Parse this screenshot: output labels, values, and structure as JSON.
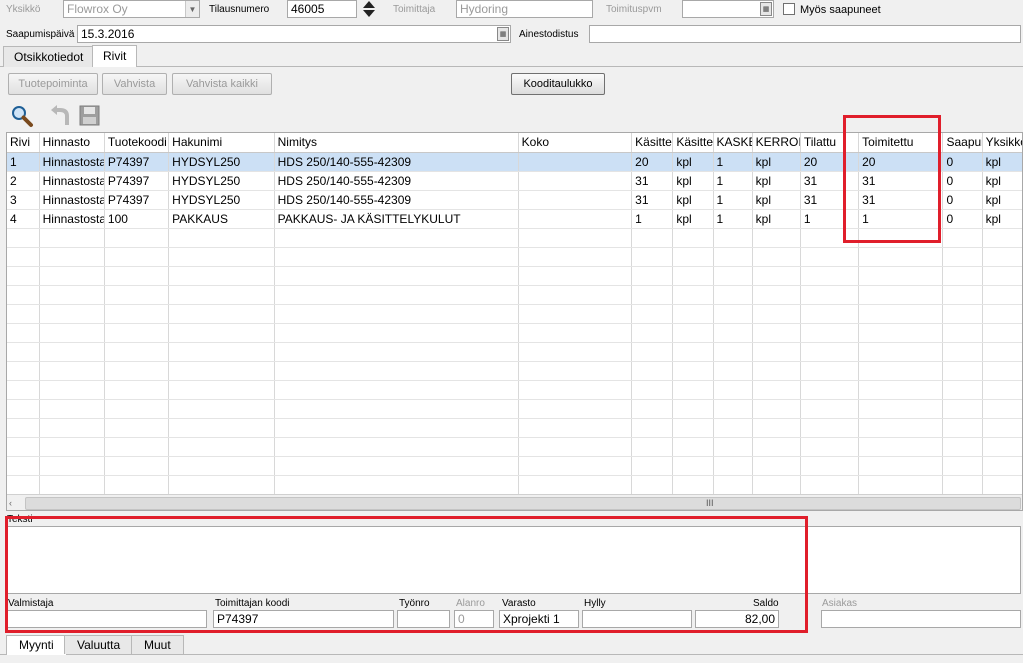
{
  "header": {
    "yksikko_label": "Yksikkö",
    "yksikko_value": "Flowrox Oy",
    "tilausnumero_label": "Tilausnumero",
    "tilausnumero_value": "46005",
    "toimittaja_label": "Toimittaja",
    "toimittaja_value": "Hydoring",
    "toimituspvm_label": "Toimituspvm",
    "toimituspvm_value": "",
    "myos_saapuneet_label": "Myös saapuneet",
    "saapumispaiva_label": "Saapumispäivä",
    "saapumispaiva_value": "15.3.2016",
    "ainestodistus_label": "Ainestodistus",
    "ainestodistus_value": ""
  },
  "tabs": [
    {
      "label": "Otsikkotiedot"
    },
    {
      "label": "Rivit"
    }
  ],
  "buttons": {
    "tuotepoiminta": "Tuotepoiminta",
    "vahvista": "Vahvista",
    "vahvista_kaikki": "Vahvista kaikki",
    "kooditaulukko": "Kooditaulukko"
  },
  "toolbar_icons": [
    "search-icon",
    "undo-icon",
    "save-icon"
  ],
  "grid": {
    "columns": [
      "Rivi",
      "Hinnasto",
      "Tuotekoodi",
      "Hakunimi",
      "Nimitys",
      "Koko",
      "Käsitte",
      "Käsitte",
      "KASKEI",
      "KERROIN",
      "Tilattu",
      "Toimitettu",
      "Saapui",
      "Yksikkö"
    ],
    "rows": [
      [
        "1",
        "Hinnastosta",
        "P74397",
        "HYDSYL250",
        "HDS 250/140-555-42309",
        "",
        "20",
        "kpl",
        "1",
        "kpl",
        "20",
        "20",
        "0",
        "kpl"
      ],
      [
        "2",
        "Hinnastosta",
        "P74397",
        "HYDSYL250",
        "HDS 250/140-555-42309",
        "",
        "31",
        "kpl",
        "1",
        "kpl",
        "31",
        "31",
        "0",
        "kpl"
      ],
      [
        "3",
        "Hinnastosta",
        "P74397",
        "HYDSYL250",
        "HDS 250/140-555-42309",
        "",
        "31",
        "kpl",
        "1",
        "kpl",
        "31",
        "31",
        "0",
        "kpl"
      ],
      [
        "4",
        "Hinnastosta",
        "100",
        "PAKKAUS",
        "PAKKAUS- JA KÄSITTELYKULUT",
        "",
        "1",
        "kpl",
        "1",
        "kpl",
        "1",
        "1",
        "0",
        "kpl"
      ]
    ],
    "selected_row": 0,
    "scrollbar_thumb": "III"
  },
  "details": {
    "teksti_label": "Teksti",
    "valmistaja_label": "Valmistaja",
    "valmistaja_value": "",
    "toimittajan_koodi_label": "Toimittajan koodi",
    "toimittajan_koodi_value": "P74397",
    "tyonro_label": "Työnro",
    "tyonro_value": "",
    "alanro_label": "Alanro",
    "alanro_value": "0",
    "varasto_label": "Varasto",
    "varasto_value": "Xprojekti 1",
    "hylly_label": "Hylly",
    "hylly_value": "",
    "saldo_label": "Saldo",
    "saldo_value": "82,00",
    "asiakas_label": "Asiakas",
    "asiakas_value": ""
  },
  "bottom_tabs": [
    {
      "label": "Myynti"
    },
    {
      "label": "Valuutta"
    },
    {
      "label": "Muut"
    }
  ],
  "colors": {
    "highlight_red": "#e01e2b",
    "selected_row": "#cce0f5"
  }
}
